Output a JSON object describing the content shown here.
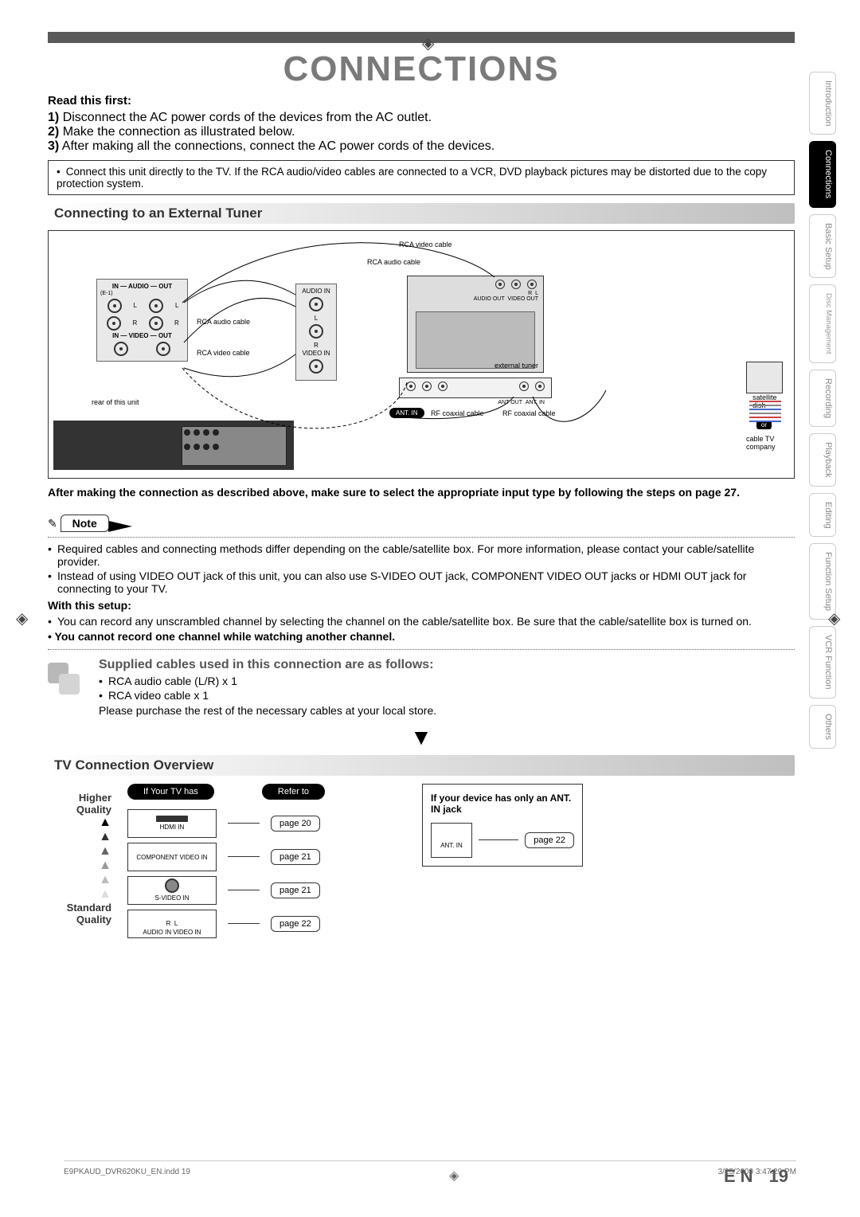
{
  "page": {
    "title": "CONNECTIONS",
    "lang": "EN",
    "number": "19"
  },
  "sidebar": [
    {
      "label": "Introduction",
      "active": false
    },
    {
      "label": "Connections",
      "active": true
    },
    {
      "label": "Basic Setup",
      "active": false
    },
    {
      "label": "Disc Management",
      "active": false,
      "sub": true
    },
    {
      "label": "Recording",
      "active": false
    },
    {
      "label": "Playback",
      "active": false
    },
    {
      "label": "Editing",
      "active": false
    },
    {
      "label": "Function Setup",
      "active": false
    },
    {
      "label": "VCR Function",
      "active": false
    },
    {
      "label": "Others",
      "active": false
    }
  ],
  "read_first": {
    "heading": "Read this first:",
    "steps": [
      {
        "n": "1)",
        "t": "Disconnect the AC power cords of the devices from the AC outlet."
      },
      {
        "n": "2)",
        "t": "Make the connection as illustrated below."
      },
      {
        "n": "3)",
        "t": "After making all the connections, connect the AC power cords of the devices."
      }
    ],
    "box": "Connect this unit directly to the TV. If the RCA audio/video cables are connected to a VCR, DVD playback pictures may be distorted due to the copy protection system."
  },
  "section1": {
    "title": "Connecting to an External Tuner",
    "labels": {
      "in_audio_out": "IN — AUDIO — OUT",
      "in_video_out": "IN — VIDEO — OUT",
      "rca_video": "RCA video cable",
      "rca_audio": "RCA audio cable",
      "rca_audio_cable": "RCA audio cable",
      "audio_in": "AUDIO IN",
      "video_in": "VIDEO IN",
      "audio_out": "AUDIO OUT",
      "video_out": "VIDEO OUT",
      "external_tuner": "external tuner",
      "satellite": "satellite dish",
      "cable_tv": "cable TV company",
      "or": "or",
      "ant_out": "ANT OUT",
      "ant_in": "ANT. IN",
      "ant_in2": "ANT. IN",
      "rf": "RF coaxial cable",
      "rear": "rear of this unit",
      "L": "L",
      "R": "R",
      "E1": "(E-1)"
    },
    "after_text": "After making the connection as described above, make sure to select the appropriate input type by following the steps on page 27."
  },
  "note": {
    "label": "Note",
    "items": [
      "Required cables and connecting methods differ depending on the cable/satellite box. For more information, please contact your cable/satellite provider.",
      "Instead of using VIDEO OUT jack of this unit, you can also use S-VIDEO OUT jack, COMPONENT VIDEO OUT jacks or HDMI OUT jack for connecting to your TV."
    ],
    "with_heading": "With this setup:",
    "with_items": [
      "You can record any unscrambled channel by selecting the channel on the cable/satellite box. Be sure that the cable/satellite box is turned on."
    ],
    "bold_line": "• You cannot record one channel while watching another channel."
  },
  "supplied": {
    "title": "Supplied cables used in this connection are as follows:",
    "items": [
      "RCA audio cable (L/R) x 1",
      "RCA video cable x 1"
    ],
    "foot": "Please purchase the rest of the necessary cables at your local store."
  },
  "section2": {
    "title": "TV Connection Overview",
    "higher": "Higher Quality",
    "standard": "Standard Quality",
    "h1": "If Your TV has",
    "h2": "Refer to",
    "rows": [
      {
        "label": "HDMI IN",
        "page": "page 20"
      },
      {
        "label": "COMPONENT VIDEO IN",
        "page": "page 21"
      },
      {
        "label": "S-VIDEO IN",
        "page": "page 21"
      },
      {
        "label": "AUDIO IN   VIDEO IN",
        "page": "page 22",
        "rl": true
      }
    ],
    "ant": {
      "title": "If your device has only an ANT. IN jack",
      "label": "ANT. IN",
      "page": "page 22"
    }
  },
  "foot": {
    "file": "E9PKAUD_DVR620KU_EN.indd   19",
    "date": "3/25/2009   3:47:29 PM"
  }
}
